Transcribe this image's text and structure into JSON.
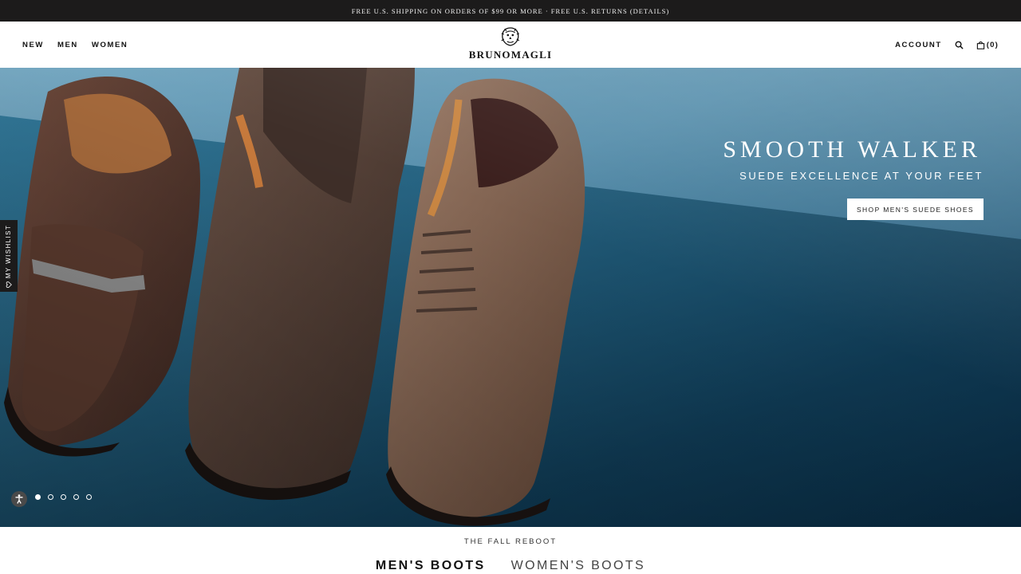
{
  "promo": {
    "text": "FREE U.S. SHIPPING ON ORDERS OF $99 OR MORE · FREE U.S. RETURNS",
    "details_label": "(DETAILS)"
  },
  "nav": {
    "left": [
      "NEW",
      "MEN",
      "WOMEN"
    ],
    "account_label": "ACCOUNT",
    "cart_count": "(0)"
  },
  "brand": {
    "name": "BRUNOMAGLI"
  },
  "hero": {
    "title": "SMOOTH WALKER",
    "subtitle": "SUEDE EXCELLENCE AT YOUR FEET",
    "cta_label": "SHOP MEN'S SUEDE SHOES",
    "slide_count": 5,
    "active_slide": 1
  },
  "wishlist": {
    "label": "MY WISHLIST"
  },
  "section": {
    "eyebrow": "THE FALL REBOOT",
    "tabs": [
      {
        "label": "MEN'S BOOTS",
        "active": true
      },
      {
        "label": "WOMEN'S BOOTS",
        "active": false
      }
    ]
  },
  "colors": {
    "promo_bg": "#1c1b1b",
    "hero_blue": "#2f6685",
    "suede_brown": "#6b4a3a"
  }
}
